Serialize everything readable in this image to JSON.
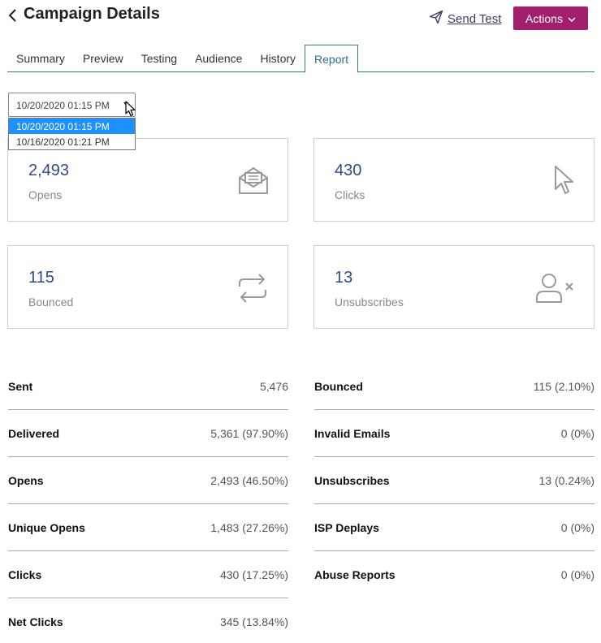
{
  "header": {
    "title": "Campaign Details",
    "send_test_label": "Send Test",
    "actions_label": "Actions"
  },
  "tabs": [
    {
      "label": "Summary"
    },
    {
      "label": "Preview"
    },
    {
      "label": "Testing"
    },
    {
      "label": "Audience"
    },
    {
      "label": "History"
    },
    {
      "label": "Report",
      "active": true
    }
  ],
  "date_select": {
    "value": "10/20/2020 01:15 PM",
    "options": [
      "10/20/2020 01:15 PM",
      "10/16/2020 01:21 PM"
    ]
  },
  "cards": [
    {
      "value": "2,493",
      "label": "Opens",
      "icon": "envelope-open-icon"
    },
    {
      "value": "430",
      "label": "Clicks",
      "icon": "cursor-pointer-icon"
    },
    {
      "value": "115",
      "label": "Bounced",
      "icon": "bounce-arrows-icon"
    },
    {
      "value": "13",
      "label": "Unsubscribes",
      "icon": "user-remove-icon"
    }
  ],
  "metrics_left": [
    {
      "label": "Sent",
      "value": "5,476"
    },
    {
      "label": "Delivered",
      "value": "5,361 (97.90%)"
    },
    {
      "label": "Opens",
      "value": "2,493 (46.50%)"
    },
    {
      "label": "Unique Opens",
      "value": "1,483 (27.26%)"
    },
    {
      "label": "Clicks",
      "value": "430 (17.25%)"
    },
    {
      "label": "Net Clicks",
      "value": "345 (13.84%)"
    }
  ],
  "metrics_right": [
    {
      "label": "Bounced",
      "value": "115 (2.10%)"
    },
    {
      "label": "Invalid Emails",
      "value": "0 (0%)"
    },
    {
      "label": "Unsubscribes",
      "value": "13 (0.24%)"
    },
    {
      "label": "ISP Deplays",
      "value": "0 (0%)"
    },
    {
      "label": "Abuse Reports",
      "value": "0 (0%)"
    }
  ],
  "colors": {
    "accent": "#a21f6e",
    "tab_border": "#2e7f8a",
    "stat_value": "#2f4b8c",
    "selected_option": "#1e90ff"
  }
}
